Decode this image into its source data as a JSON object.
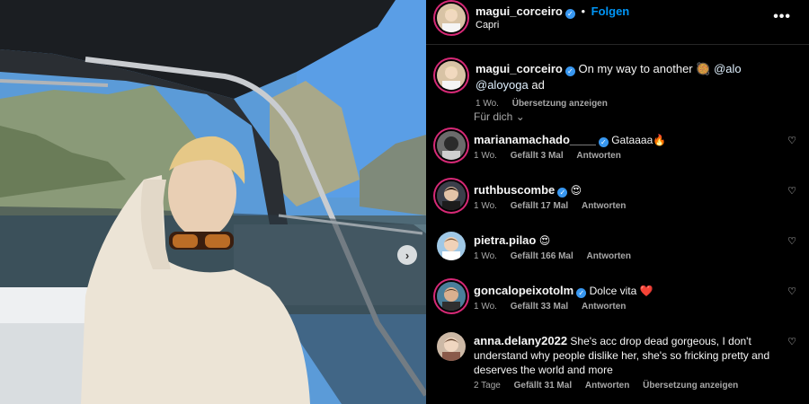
{
  "post": {
    "author": "magui_corceiro",
    "follow_label": "Folgen",
    "location": "Capri",
    "more_icon": "more-horizontal-icon"
  },
  "caption": {
    "author": "magui_corceiro",
    "text": "On my way to another",
    "mentions": "@alo @aloyoga",
    "suffix": "ad",
    "time": "1 Wo.",
    "translate": "Übersetzung anzeigen"
  },
  "sort_label": "Für dich",
  "comments": [
    {
      "user": "marianamachado____",
      "text": "Gataaaa🔥",
      "time": "1 Wo.",
      "likes": "Gefällt 3 Mal",
      "reply": "Antworten",
      "verified": true
    },
    {
      "user": "ruthbuscombe",
      "text": "😍",
      "time": "1 Wo.",
      "likes": "Gefällt 17 Mal",
      "reply": "Antworten",
      "verified": true
    },
    {
      "user": "pietra.pilao",
      "text": "😍",
      "time": "1 Wo.",
      "likes": "Gefällt 166 Mal",
      "reply": "Antworten",
      "verified": false
    },
    {
      "user": "goncalopeixotolm",
      "text": "Dolce vita ❤️",
      "time": "1 Wo.",
      "likes": "Gefällt 33 Mal",
      "reply": "Antworten",
      "verified": true
    },
    {
      "user": "anna.delany2022",
      "text": "She's acc drop dead gorgeous, I don't understand why people dislike her, she's so fricking pretty and deserves the world and more",
      "time": "2 Tage",
      "likes": "Gefällt 31 Mal",
      "reply": "Antworten",
      "translate": "Übersetzung anzeigen",
      "verified": false
    }
  ],
  "colors": {
    "follow": "#0095f6",
    "verified": "#3897f0",
    "meta": "#a8a8a8"
  }
}
